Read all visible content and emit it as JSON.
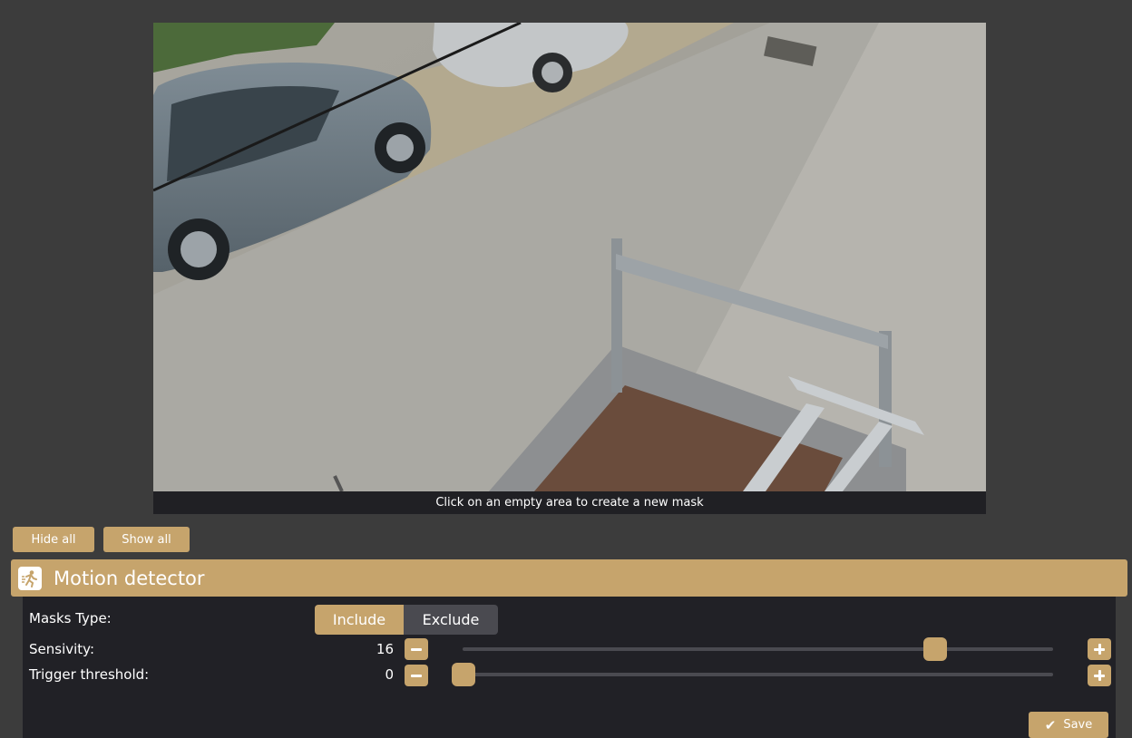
{
  "video": {
    "hint": "Click on an empty area to create a new mask"
  },
  "toolbar": {
    "hide_all": "Hide all",
    "show_all": "Show all"
  },
  "section": {
    "title": "Motion detector",
    "icon": "running-person-icon"
  },
  "settings": {
    "masks_type_label": "Masks Type:",
    "masks_type_options": [
      "Include",
      "Exclude"
    ],
    "masks_type_selected": "Include",
    "sensitivity_label": "Sensivity:",
    "sensitivity_value": "16",
    "sensitivity_fraction": 0.8,
    "trigger_label": "Trigger threshold:",
    "trigger_value": "0",
    "trigger_fraction": 0.0
  },
  "footer": {
    "save_label": "Save",
    "save_icon": "check-icon"
  },
  "colors": {
    "accent": "#c6a46c",
    "panel": "#212126",
    "background": "#3c3c3c"
  }
}
